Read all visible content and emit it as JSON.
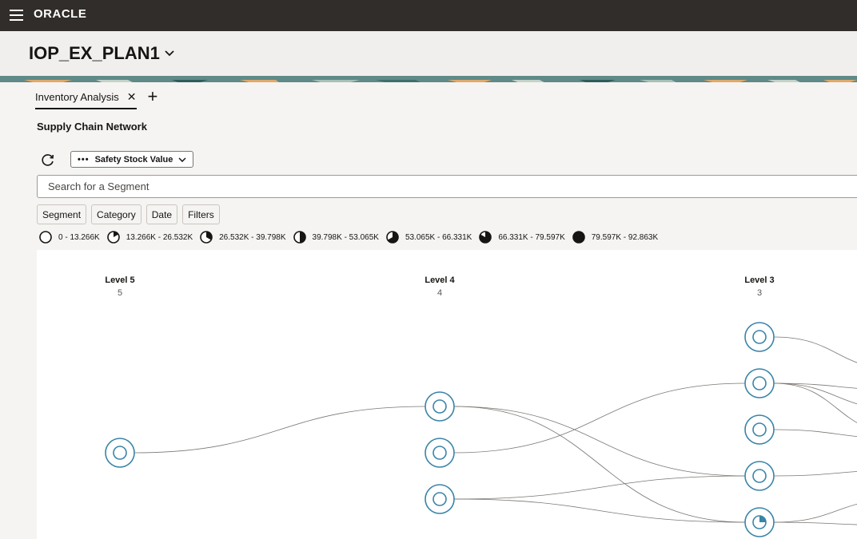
{
  "topbar": {
    "logo": "ORACLE",
    "menu_icon": "hamburger-icon"
  },
  "header": {
    "plan_name": "IOP_EX_PLAN1"
  },
  "tabs": [
    {
      "label": "Inventory Analysis",
      "active": true
    }
  ],
  "section": {
    "title": "Supply Chain Network"
  },
  "toolbar": {
    "measure_label": "Safety Stock Value",
    "refresh_icon": "refresh-icon"
  },
  "search": {
    "placeholder": "Search for a Segment",
    "value": ""
  },
  "filters": [
    "Segment",
    "Category",
    "Date",
    "Filters"
  ],
  "legend": [
    {
      "label": "0 - 13.266K",
      "fill": 0
    },
    {
      "label": "13.266K - 26.532K",
      "fill": 0.167
    },
    {
      "label": "26.532K - 39.798K",
      "fill": 0.333
    },
    {
      "label": "39.798K - 53.065K",
      "fill": 0.5
    },
    {
      "label": "53.065K - 66.331K",
      "fill": 0.667
    },
    {
      "label": "66.331K - 79.597K",
      "fill": 0.833
    },
    {
      "label": "79.597K - 92.863K",
      "fill": 1
    }
  ],
  "network": {
    "levels": [
      {
        "label": "Level 5",
        "count": "5"
      },
      {
        "label": "Level 4",
        "count": "4"
      },
      {
        "label": "Level 3",
        "count": "3"
      }
    ],
    "node_fills": {
      "level5": [
        0
      ],
      "level4": [
        0,
        0,
        0
      ],
      "level3": [
        0,
        0,
        0,
        0,
        0.25
      ]
    }
  },
  "colors": {
    "topbar": "#312d2a",
    "node_stroke": "#3a84a8",
    "edge": "#7a7672"
  }
}
